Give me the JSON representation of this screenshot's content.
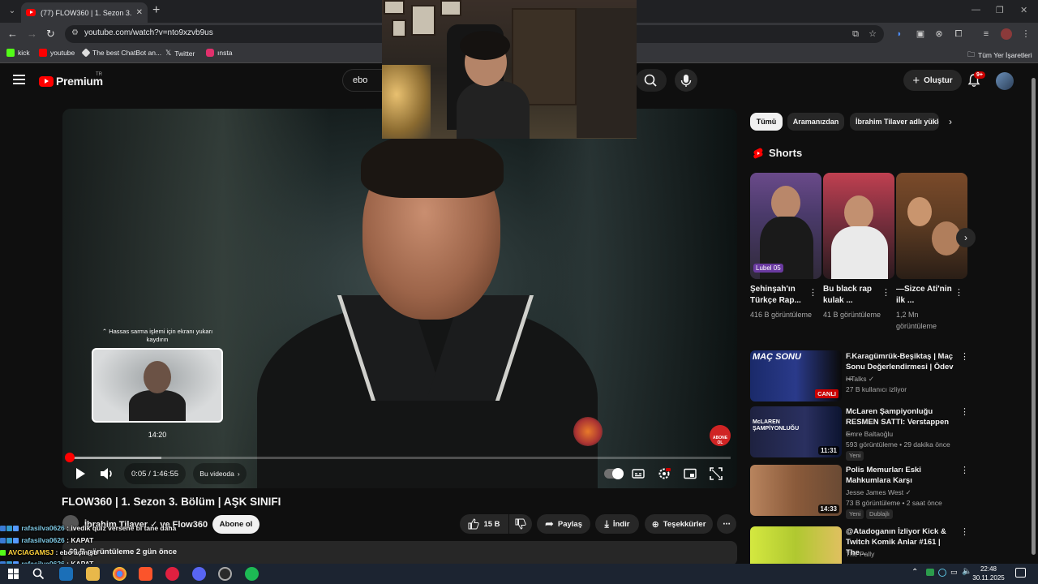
{
  "browser": {
    "tab_title": "(77) FLOW360 | 1. Sezon 3. Bölüm",
    "url": "youtube.com/watch?v=nto9xzvb9us",
    "bookmarks": [
      {
        "label": "kick",
        "icon": "kick-icon",
        "color": "#53fc18"
      },
      {
        "label": "youtube",
        "icon": "youtube-icon",
        "color": "#ff0000"
      },
      {
        "label": "The best ChatBot an...",
        "icon": "chatbot-icon",
        "color": "#ffffff"
      },
      {
        "label": "Twitter",
        "icon": "x-icon",
        "color": "#ffffff"
      },
      {
        "label": "ınsta",
        "icon": "instagram-icon",
        "color": "#e1306c"
      }
    ],
    "other_bookmarks": "Tüm Yer İşaretleri"
  },
  "header": {
    "logo": "Premium",
    "country": "TR",
    "search_value": "ebo",
    "create_label": "Oluştur",
    "notification_count": "9+"
  },
  "player": {
    "scrub_hint": "⌃ Hassas sarma işlemi için ekranı yukarı kaydırın",
    "scrub_time": "14:20",
    "time_display": "0:05 / 1:46:55",
    "chapter_label": "Bu videoda",
    "progress_played": 0.001,
    "progress_buffer": 0.14,
    "subscribe_badge": "ABONE OL"
  },
  "video": {
    "title": "FLOW360 | 1. Sezon 3. Bölüm | AŞK SINIFI",
    "channel": "İbrahim Tilaver ✓ ve Flow360",
    "subscribe_label": "Abone ol",
    "likes": "15 B",
    "share_label": "Paylaş",
    "download_label": "İndir",
    "thanks_label": "Teşekkürler",
    "desc_meta": "60 B görüntüleme  2 gün önce"
  },
  "chat": [
    {
      "user": "rafasilva0626",
      "message": "ivedik quiz versene bi tane daha",
      "color": "#7ec8e3"
    },
    {
      "user": "rafasilva0626",
      "message": "KAPAT",
      "color": "#7ec8e3"
    },
    {
      "user": "AVCIAGAMSJ",
      "message": "ebo açmıştı",
      "color": "#ffd23c"
    },
    {
      "user": "rafasilva0626",
      "message": "KAPAT",
      "color": "#7ec8e3"
    }
  ],
  "chips": [
    "Tümü",
    "Aramanızdan",
    "İbrahim Tilaver adlı yükleyici"
  ],
  "shorts": {
    "heading": "Shorts",
    "items": [
      {
        "title": "Şehinşah'ın Türkçe Rap...",
        "views": "416 B görüntüleme",
        "overlay": "Lubel 05"
      },
      {
        "title": "Bu black rap kulak ...",
        "views": "41 B görüntüleme",
        "overlay": ""
      },
      {
        "title": "—Sizce Ati'nin ilk ...",
        "views": "1,2 Mn görüntüleme",
        "overlay": ""
      }
    ]
  },
  "recommendations": [
    {
      "title": "F.Karagümrük-Beşiktaş | Maç Sonu Değerlendirmesi | Ödev ...",
      "channel": "HTalks ✓",
      "meta": "27 B kullanıcı izliyor",
      "thumb_text": "MAÇ SONU",
      "live_label": "CANLI",
      "duration": "",
      "badge": ""
    },
    {
      "title": "McLaren Şampiyonluğu RESMEN SATTI: Verstappen ...",
      "channel": "Emre Baltaoğlu",
      "meta": "593 görüntüleme • 29 dakika önce",
      "thumb_text": "McLAREN ŞAMPİYONLUĞU",
      "live_label": "",
      "duration": "11:31",
      "badge": "Yeni"
    },
    {
      "title": "Polis Memurları Eski Mahkumlara Karşı",
      "channel": "Jesse James West ✓",
      "meta": "73 B görüntüleme • 2 saat önce",
      "thumb_text": "",
      "live_label": "",
      "duration": "14:33",
      "badge": "Yeni",
      "badge2": "Dublajlı"
    },
    {
      "title": "@Atadoganın İzliyor Kick & Twitch Komik Anlar #161 | The...",
      "channel": "The Pally",
      "meta": "",
      "thumb_text": "",
      "live_label": "",
      "duration": "",
      "badge": ""
    }
  ],
  "taskbar": {
    "time": "22:48",
    "date": "30.11.2025"
  }
}
